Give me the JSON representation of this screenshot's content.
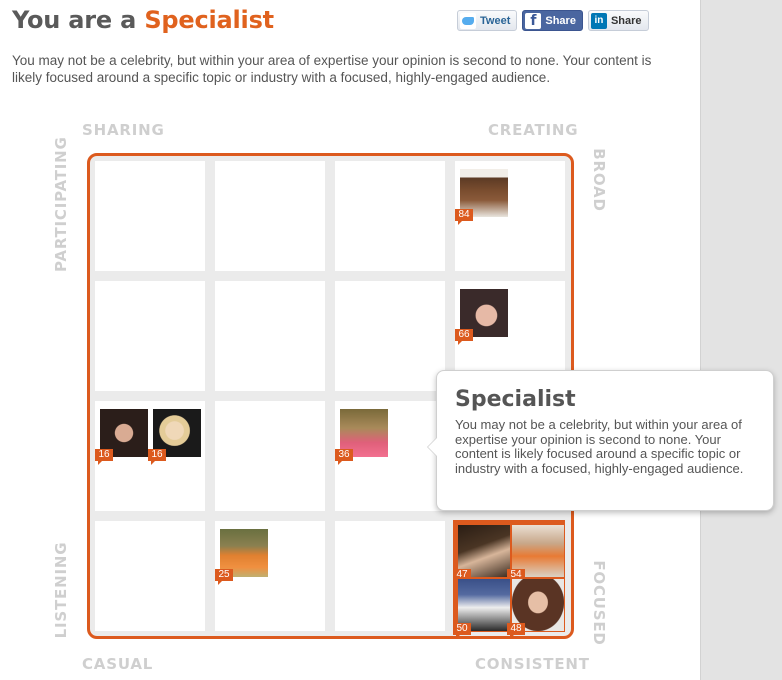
{
  "header": {
    "title_prefix": "You are a ",
    "title_type": "Specialist",
    "description": "You may not be a celebrity, but within your area of expertise your opinion is second to none. Your content is likely focused around a specific topic or industry with a focused, highly-engaged audience."
  },
  "share": {
    "tweet_label": "Tweet",
    "facebook_label": "Share",
    "facebook_glyph": "f",
    "linkedin_label": "Share",
    "linkedin_glyph": "in"
  },
  "axes": {
    "top_left": "SHARING",
    "top_right": "CREATING",
    "left_top": "PARTICIPATING",
    "left_bottom": "LISTENING",
    "right_top": "BROAD",
    "right_bottom": "FOCUSED",
    "bottom_left": "CASUAL",
    "bottom_right": "CONSISTENT"
  },
  "matrix": {
    "avatars": [
      {
        "score": "84"
      },
      {
        "score": "66"
      },
      {
        "score": "16"
      },
      {
        "score": "16"
      },
      {
        "score": "36"
      },
      {
        "score": "25"
      },
      {
        "score": "47"
      },
      {
        "score": "54"
      },
      {
        "score": "50"
      },
      {
        "score": "48"
      }
    ]
  },
  "tooltip": {
    "title": "Specialist",
    "body": "You may not be a celebrity, but within your area of expertise your opinion is second to none. Your content is likely focused around a specific topic or industry with a focused, highly-engaged audience."
  },
  "colors": {
    "accent": "#dc5a1e",
    "axis_label": "#cfcfcf",
    "grid_gap": "#ebebeb"
  }
}
